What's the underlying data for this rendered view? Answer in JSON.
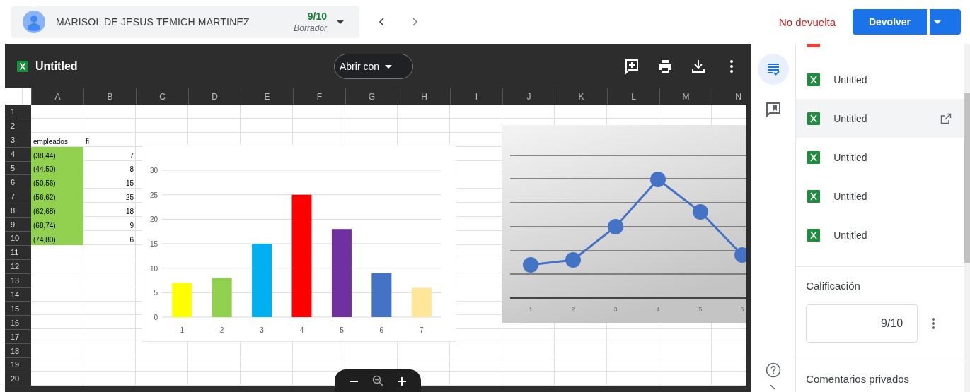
{
  "student": {
    "name": "MARISOL DE JESUS TEMICH MARTINEZ",
    "grade": "9/10",
    "status": "Borrador"
  },
  "return_status": "No devuelta",
  "return_button": "Devolver",
  "viewer": {
    "file_title": "Untitled",
    "open_with": "Abrir con"
  },
  "sheet": {
    "columns": [
      "A",
      "B",
      "C",
      "D",
      "E",
      "F",
      "G",
      "H",
      "I",
      "J",
      "K",
      "L",
      "M",
      "N"
    ],
    "rows": [
      {
        "number": "1",
        "cells": []
      },
      {
        "number": "2",
        "cells": []
      },
      {
        "number": "3",
        "cells": [
          {
            "text": "empleados",
            "kind": "text",
            "highlighted": false
          },
          {
            "text": "fi",
            "kind": "text",
            "highlighted": false
          }
        ]
      },
      {
        "number": "4",
        "cells": [
          {
            "text": "(38,44)",
            "kind": "text",
            "highlighted": true
          },
          {
            "text": "7",
            "kind": "number",
            "highlighted": false
          }
        ]
      },
      {
        "number": "5",
        "cells": [
          {
            "text": "(44,50)",
            "kind": "text",
            "highlighted": true
          },
          {
            "text": "8",
            "kind": "number",
            "highlighted": false
          }
        ]
      },
      {
        "number": "6",
        "cells": [
          {
            "text": "(50,56)",
            "kind": "text",
            "highlighted": true
          },
          {
            "text": "15",
            "kind": "number",
            "highlighted": false
          }
        ]
      },
      {
        "number": "7",
        "cells": [
          {
            "text": "(56,62)",
            "kind": "text",
            "highlighted": true
          },
          {
            "text": "25",
            "kind": "number",
            "highlighted": false
          }
        ]
      },
      {
        "number": "8",
        "cells": [
          {
            "text": "(62,68)",
            "kind": "text",
            "highlighted": true
          },
          {
            "text": "18",
            "kind": "number",
            "highlighted": false
          }
        ]
      },
      {
        "number": "9",
        "cells": [
          {
            "text": "(68,74)",
            "kind": "text",
            "highlighted": true
          },
          {
            "text": "9",
            "kind": "number",
            "highlighted": false
          }
        ]
      },
      {
        "number": "10",
        "cells": [
          {
            "text": "(74,80)",
            "kind": "text",
            "highlighted": true
          },
          {
            "text": "6",
            "kind": "number",
            "highlighted": false
          }
        ]
      },
      {
        "number": "11",
        "cells": []
      },
      {
        "number": "12",
        "cells": []
      },
      {
        "number": "13",
        "cells": []
      },
      {
        "number": "14",
        "cells": []
      },
      {
        "number": "15",
        "cells": []
      },
      {
        "number": "16",
        "cells": []
      },
      {
        "number": "17",
        "cells": []
      },
      {
        "number": "18",
        "cells": []
      },
      {
        "number": "19",
        "cells": []
      },
      {
        "number": "20",
        "cells": []
      }
    ],
    "bar_chart": {
      "chart_data": {
        "type": "bar",
        "categories": [
          "1",
          "2",
          "3",
          "4",
          "5",
          "6",
          "7"
        ],
        "series": [
          {
            "colors": [
              "#ffff00",
              "#92d050",
              "#00b0f0",
              "#ff0000",
              "#7030a0",
              "#4472c4",
              "#ffe699"
            ],
            "values": [
              7,
              8,
              15,
              25,
              18,
              9,
              6
            ]
          }
        ],
        "ylim": [
          0,
          30
        ],
        "yticks": [
          0,
          5,
          10,
          15,
          20,
          25,
          30
        ],
        "grid": true
      }
    },
    "line_chart": {
      "x_labels": [
        "1",
        "2",
        "3",
        "4",
        "5",
        "6"
      ]
    }
  },
  "files": [
    {
      "kind": "document",
      "selected": false
    },
    {
      "title": "Untitled",
      "kind": "spreadsheet",
      "selected": false
    },
    {
      "title": "Untitled",
      "kind": "spreadsheet",
      "selected": true
    },
    {
      "title": "Untitled",
      "kind": "spreadsheet",
      "selected": false
    },
    {
      "title": "Untitled",
      "kind": "spreadsheet",
      "selected": false
    },
    {
      "title": "Untitled",
      "kind": "spreadsheet",
      "selected": false
    }
  ],
  "rail": [
    {
      "selected": true
    },
    {
      "selected": false
    }
  ],
  "grade_section": {
    "heading": "Calificación",
    "value": "9/10"
  },
  "private_comments": {
    "heading": "Comentarios privados"
  }
}
